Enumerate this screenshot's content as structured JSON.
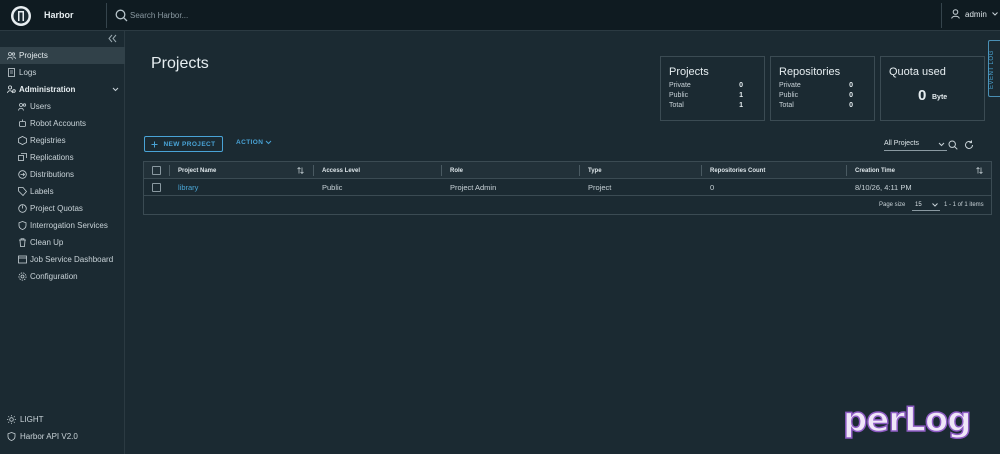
{
  "header": {
    "brand": "Harbor",
    "search_placeholder": "Search Harbor...",
    "user": "admin"
  },
  "sidebar": {
    "items": [
      {
        "label": "Projects",
        "icon": "projects-icon",
        "active": true
      },
      {
        "label": "Logs",
        "icon": "logs-icon"
      }
    ],
    "admin_group": "Administration",
    "admin_items": [
      {
        "label": "Users",
        "icon": "users-icon"
      },
      {
        "label": "Robot Accounts",
        "icon": "robot-icon"
      },
      {
        "label": "Registries",
        "icon": "registries-icon"
      },
      {
        "label": "Replications",
        "icon": "replications-icon"
      },
      {
        "label": "Distributions",
        "icon": "distributions-icon"
      },
      {
        "label": "Labels",
        "icon": "label-icon"
      },
      {
        "label": "Project Quotas",
        "icon": "quota-icon"
      },
      {
        "label": "Interrogation Services",
        "icon": "shield-icon"
      },
      {
        "label": "Clean Up",
        "icon": "trash-icon"
      },
      {
        "label": "Job Service Dashboard",
        "icon": "dashboard-icon"
      },
      {
        "label": "Configuration",
        "icon": "gear-icon"
      }
    ],
    "theme_toggle": "LIGHT",
    "api_link": "Harbor API V2.0"
  },
  "main": {
    "title": "Projects",
    "cards": {
      "projects": {
        "title": "Projects",
        "rows": [
          {
            "label": "Private",
            "value": "0"
          },
          {
            "label": "Public",
            "value": "1"
          },
          {
            "label": "Total",
            "value": "1"
          }
        ]
      },
      "repositories": {
        "title": "Repositories",
        "rows": [
          {
            "label": "Private",
            "value": "0"
          },
          {
            "label": "Public",
            "value": "0"
          },
          {
            "label": "Total",
            "value": "0"
          }
        ]
      },
      "quota": {
        "title": "Quota used",
        "value": "0",
        "unit": "Byte"
      }
    },
    "event_log": "EVENT LOG",
    "new_project": "NEW PROJECT",
    "action": "ACTION",
    "filter": "All Projects",
    "table": {
      "headers": [
        "Project Name",
        "Access Level",
        "Role",
        "Type",
        "Repositories Count",
        "Creation Time"
      ],
      "rows": [
        {
          "name": "library",
          "access": "Public",
          "role": "Project Admin",
          "type": "Project",
          "repos": "0",
          "created": "8/10/26, 4:11 PM"
        }
      ],
      "page_size_label": "Page size",
      "page_size": "15",
      "page_info": "1 - 1 of 1 items"
    }
  },
  "watermark": "perLog",
  "colors": {
    "accent": "#49a3d6",
    "background": "#1b2a32",
    "header": "#0f1b21"
  }
}
